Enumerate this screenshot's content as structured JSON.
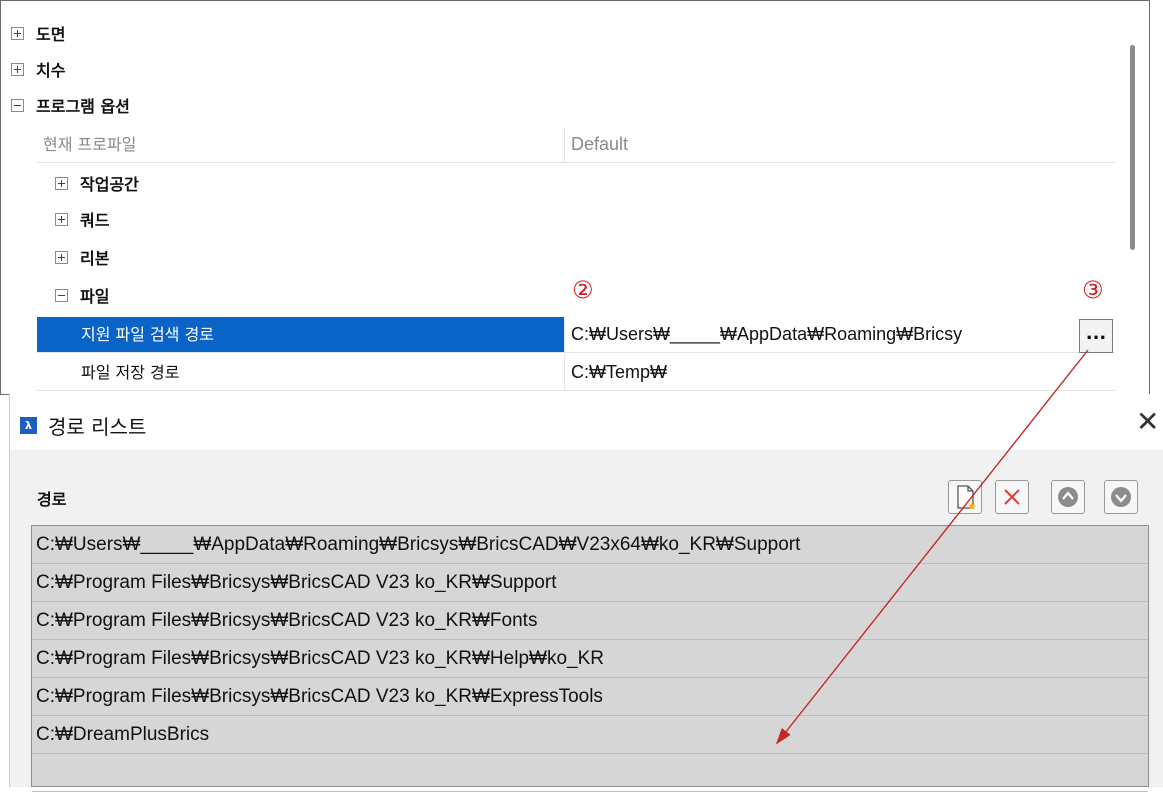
{
  "tree": {
    "drawing_label": "도면",
    "dimension_label": "치수",
    "program_options_label": "프로그램 옵션",
    "current_profile_label": "현재 프로파일",
    "current_profile_value": "Default",
    "workspace_label": "작업공간",
    "quad_label": "쿼드",
    "ribbon_label": "리본",
    "files_label": "파일",
    "support_path_label": "지원 파일 검색 경로",
    "support_path_value": "C:₩Users₩_____₩AppData₩Roaming₩Bricsy",
    "save_path_label": "파일 저장 경로",
    "save_path_value": "C:₩Temp₩",
    "browse_button_label": "..."
  },
  "annotations": {
    "marker_2": "②",
    "marker_3": "③",
    "arrow_color": "#c62828"
  },
  "dialog": {
    "title": "경로 리스트",
    "path_label": "경로",
    "toolbar": {
      "new_icon": "new-file-icon",
      "delete_icon": "delete-x-icon",
      "up_icon": "move-up-icon",
      "down_icon": "move-down-icon"
    },
    "paths": [
      "C:₩Users₩_____₩AppData₩Roaming₩Bricsys₩BricsCAD₩V23x64₩ko_KR₩Support",
      "C:₩Program Files₩Bricsys₩BricsCAD V23 ko_KR₩Support",
      "C:₩Program Files₩Bricsys₩BricsCAD V23 ko_KR₩Fonts",
      "C:₩Program Files₩Bricsys₩BricsCAD V23 ko_KR₩Help₩ko_KR",
      "C:₩Program Files₩Bricsys₩BricsCAD V23 ko_KR₩ExpressTools",
      "C:₩DreamPlusBrics",
      ""
    ]
  },
  "colors": {
    "selection_blue": "#0a64c8",
    "list_bg": "#d6d6d6",
    "dialog_bg": "#f1f1f1"
  }
}
